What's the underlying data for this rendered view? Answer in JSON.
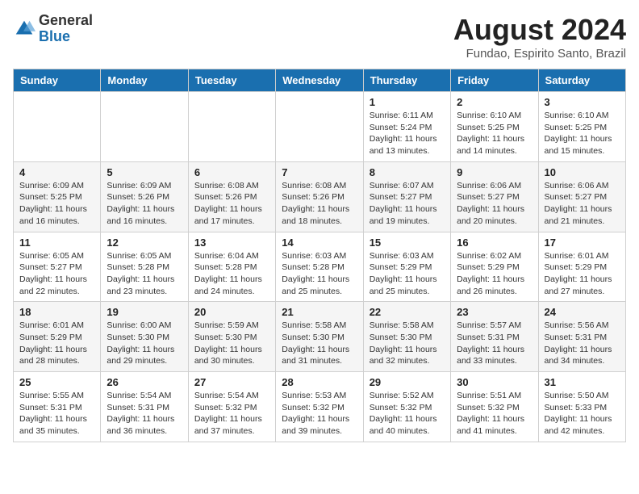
{
  "logo": {
    "general": "General",
    "blue": "Blue"
  },
  "title": "August 2024",
  "subtitle": "Fundao, Espirito Santo, Brazil",
  "days_of_week": [
    "Sunday",
    "Monday",
    "Tuesday",
    "Wednesday",
    "Thursday",
    "Friday",
    "Saturday"
  ],
  "weeks": [
    [
      {
        "day": "",
        "sunrise": "",
        "sunset": "",
        "daylight": ""
      },
      {
        "day": "",
        "sunrise": "",
        "sunset": "",
        "daylight": ""
      },
      {
        "day": "",
        "sunrise": "",
        "sunset": "",
        "daylight": ""
      },
      {
        "day": "",
        "sunrise": "",
        "sunset": "",
        "daylight": ""
      },
      {
        "day": "1",
        "sunrise": "Sunrise: 6:11 AM",
        "sunset": "Sunset: 5:24 PM",
        "daylight": "Daylight: 11 hours and 13 minutes."
      },
      {
        "day": "2",
        "sunrise": "Sunrise: 6:10 AM",
        "sunset": "Sunset: 5:25 PM",
        "daylight": "Daylight: 11 hours and 14 minutes."
      },
      {
        "day": "3",
        "sunrise": "Sunrise: 6:10 AM",
        "sunset": "Sunset: 5:25 PM",
        "daylight": "Daylight: 11 hours and 15 minutes."
      }
    ],
    [
      {
        "day": "4",
        "sunrise": "Sunrise: 6:09 AM",
        "sunset": "Sunset: 5:25 PM",
        "daylight": "Daylight: 11 hours and 16 minutes."
      },
      {
        "day": "5",
        "sunrise": "Sunrise: 6:09 AM",
        "sunset": "Sunset: 5:26 PM",
        "daylight": "Daylight: 11 hours and 16 minutes."
      },
      {
        "day": "6",
        "sunrise": "Sunrise: 6:08 AM",
        "sunset": "Sunset: 5:26 PM",
        "daylight": "Daylight: 11 hours and 17 minutes."
      },
      {
        "day": "7",
        "sunrise": "Sunrise: 6:08 AM",
        "sunset": "Sunset: 5:26 PM",
        "daylight": "Daylight: 11 hours and 18 minutes."
      },
      {
        "day": "8",
        "sunrise": "Sunrise: 6:07 AM",
        "sunset": "Sunset: 5:27 PM",
        "daylight": "Daylight: 11 hours and 19 minutes."
      },
      {
        "day": "9",
        "sunrise": "Sunrise: 6:06 AM",
        "sunset": "Sunset: 5:27 PM",
        "daylight": "Daylight: 11 hours and 20 minutes."
      },
      {
        "day": "10",
        "sunrise": "Sunrise: 6:06 AM",
        "sunset": "Sunset: 5:27 PM",
        "daylight": "Daylight: 11 hours and 21 minutes."
      }
    ],
    [
      {
        "day": "11",
        "sunrise": "Sunrise: 6:05 AM",
        "sunset": "Sunset: 5:27 PM",
        "daylight": "Daylight: 11 hours and 22 minutes."
      },
      {
        "day": "12",
        "sunrise": "Sunrise: 6:05 AM",
        "sunset": "Sunset: 5:28 PM",
        "daylight": "Daylight: 11 hours and 23 minutes."
      },
      {
        "day": "13",
        "sunrise": "Sunrise: 6:04 AM",
        "sunset": "Sunset: 5:28 PM",
        "daylight": "Daylight: 11 hours and 24 minutes."
      },
      {
        "day": "14",
        "sunrise": "Sunrise: 6:03 AM",
        "sunset": "Sunset: 5:28 PM",
        "daylight": "Daylight: 11 hours and 25 minutes."
      },
      {
        "day": "15",
        "sunrise": "Sunrise: 6:03 AM",
        "sunset": "Sunset: 5:29 PM",
        "daylight": "Daylight: 11 hours and 25 minutes."
      },
      {
        "day": "16",
        "sunrise": "Sunrise: 6:02 AM",
        "sunset": "Sunset: 5:29 PM",
        "daylight": "Daylight: 11 hours and 26 minutes."
      },
      {
        "day": "17",
        "sunrise": "Sunrise: 6:01 AM",
        "sunset": "Sunset: 5:29 PM",
        "daylight": "Daylight: 11 hours and 27 minutes."
      }
    ],
    [
      {
        "day": "18",
        "sunrise": "Sunrise: 6:01 AM",
        "sunset": "Sunset: 5:29 PM",
        "daylight": "Daylight: 11 hours and 28 minutes."
      },
      {
        "day": "19",
        "sunrise": "Sunrise: 6:00 AM",
        "sunset": "Sunset: 5:30 PM",
        "daylight": "Daylight: 11 hours and 29 minutes."
      },
      {
        "day": "20",
        "sunrise": "Sunrise: 5:59 AM",
        "sunset": "Sunset: 5:30 PM",
        "daylight": "Daylight: 11 hours and 30 minutes."
      },
      {
        "day": "21",
        "sunrise": "Sunrise: 5:58 AM",
        "sunset": "Sunset: 5:30 PM",
        "daylight": "Daylight: 11 hours and 31 minutes."
      },
      {
        "day": "22",
        "sunrise": "Sunrise: 5:58 AM",
        "sunset": "Sunset: 5:30 PM",
        "daylight": "Daylight: 11 hours and 32 minutes."
      },
      {
        "day": "23",
        "sunrise": "Sunrise: 5:57 AM",
        "sunset": "Sunset: 5:31 PM",
        "daylight": "Daylight: 11 hours and 33 minutes."
      },
      {
        "day": "24",
        "sunrise": "Sunrise: 5:56 AM",
        "sunset": "Sunset: 5:31 PM",
        "daylight": "Daylight: 11 hours and 34 minutes."
      }
    ],
    [
      {
        "day": "25",
        "sunrise": "Sunrise: 5:55 AM",
        "sunset": "Sunset: 5:31 PM",
        "daylight": "Daylight: 11 hours and 35 minutes."
      },
      {
        "day": "26",
        "sunrise": "Sunrise: 5:54 AM",
        "sunset": "Sunset: 5:31 PM",
        "daylight": "Daylight: 11 hours and 36 minutes."
      },
      {
        "day": "27",
        "sunrise": "Sunrise: 5:54 AM",
        "sunset": "Sunset: 5:32 PM",
        "daylight": "Daylight: 11 hours and 37 minutes."
      },
      {
        "day": "28",
        "sunrise": "Sunrise: 5:53 AM",
        "sunset": "Sunset: 5:32 PM",
        "daylight": "Daylight: 11 hours and 39 minutes."
      },
      {
        "day": "29",
        "sunrise": "Sunrise: 5:52 AM",
        "sunset": "Sunset: 5:32 PM",
        "daylight": "Daylight: 11 hours and 40 minutes."
      },
      {
        "day": "30",
        "sunrise": "Sunrise: 5:51 AM",
        "sunset": "Sunset: 5:32 PM",
        "daylight": "Daylight: 11 hours and 41 minutes."
      },
      {
        "day": "31",
        "sunrise": "Sunrise: 5:50 AM",
        "sunset": "Sunset: 5:33 PM",
        "daylight": "Daylight: 11 hours and 42 minutes."
      }
    ]
  ]
}
